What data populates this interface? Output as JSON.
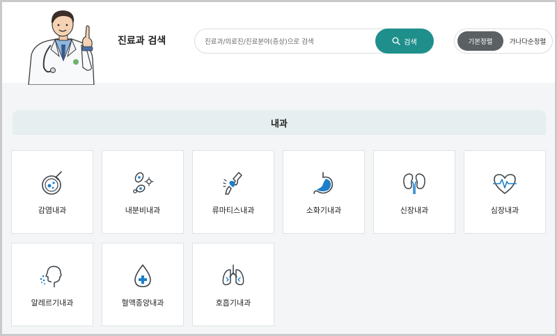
{
  "header": {
    "title": "진료과 검색",
    "search_placeholder": "진료과/의료진/진료분야(증상)으로 검색",
    "search_button": "검색",
    "sort": {
      "default": "기본정렬",
      "alpha": "가나다순정렬"
    }
  },
  "section": {
    "title": "내과"
  },
  "departments": [
    {
      "label": "감염내과",
      "icon": "petri-dish-icon"
    },
    {
      "label": "내분비내과",
      "icon": "cells-icon"
    },
    {
      "label": "류마티스내과",
      "icon": "joint-icon"
    },
    {
      "label": "소화기내과",
      "icon": "stomach-icon"
    },
    {
      "label": "신장내과",
      "icon": "kidney-icon"
    },
    {
      "label": "심장내과",
      "icon": "heart-pulse-icon"
    },
    {
      "label": "알레르기내과",
      "icon": "sneeze-icon"
    },
    {
      "label": "혈액종양내과",
      "icon": "blood-drop-icon"
    },
    {
      "label": "호흡기내과",
      "icon": "lungs-icon"
    }
  ],
  "colors": {
    "accent": "#1f8f8c",
    "icon_blue": "#1e7fc8",
    "icon_dark": "#3b4248"
  }
}
